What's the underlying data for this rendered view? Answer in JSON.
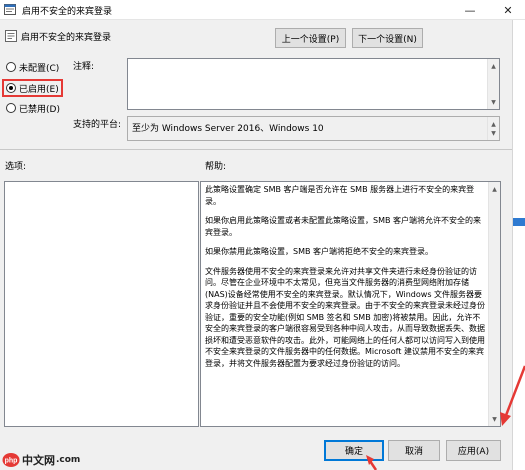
{
  "window": {
    "title": "启用不安全的来宾登录"
  },
  "policy": {
    "name": "启用不安全的来宾登录",
    "prev_button": "上一个设置(P)",
    "next_button": "下一个设置(N)"
  },
  "state_options": {
    "not_configured": "未配置(C)",
    "enabled": "已启用(E)",
    "disabled": "已禁用(D)",
    "selected": "enabled"
  },
  "comment": {
    "label": "注释:",
    "value": ""
  },
  "supported_on": {
    "label": "支持的平台:",
    "value": "至少为 Windows Server 2016、Windows 10"
  },
  "options": {
    "label": "选项:"
  },
  "help": {
    "label": "帮助:",
    "paragraphs": [
      "此策略设置确定 SMB 客户端是否允许在 SMB 服务器上进行不安全的来宾登录。",
      "如果你启用此策略设置或者未配置此策略设置，SMB 客户端将允许不安全的来宾登录。",
      "如果你禁用此策略设置，SMB 客户端将拒绝不安全的来宾登录。",
      "文件服务器使用不安全的来宾登录来允许对共享文件夹进行未经身份验证的访问。尽管在企业环境中不太常见，但充当文件服务器的消费型网络附加存储(NAS)设备经常使用不安全的来宾登录。默认情况下，Windows 文件服务器要求身份验证并且不会使用不安全的来宾登录。由于不安全的来宾登录未经过身份验证，重要的安全功能(例如 SMB 签名和 SMB 加密)将被禁用。因此，允许不安全的来宾登录的客户端很容易受到各种中间人攻击，从而导致数据丢失、数据损坏和遭受恶意软件的攻击。此外，可能网络上的任何人都可以访问写入到使用不安全来宾登录的文件服务器中的任何数据。Microsoft 建议禁用不安全的来宾登录，并将文件服务器配置为要求经过身份验证的访问。"
    ]
  },
  "footer": {
    "ok": "确定",
    "cancel": "取消",
    "apply": "应用(A)"
  },
  "watermark": {
    "text": "中文网",
    "url": ".com"
  },
  "colors": {
    "highlight": "#e53935",
    "focus": "#0078d7",
    "watermark": "#e53935"
  }
}
